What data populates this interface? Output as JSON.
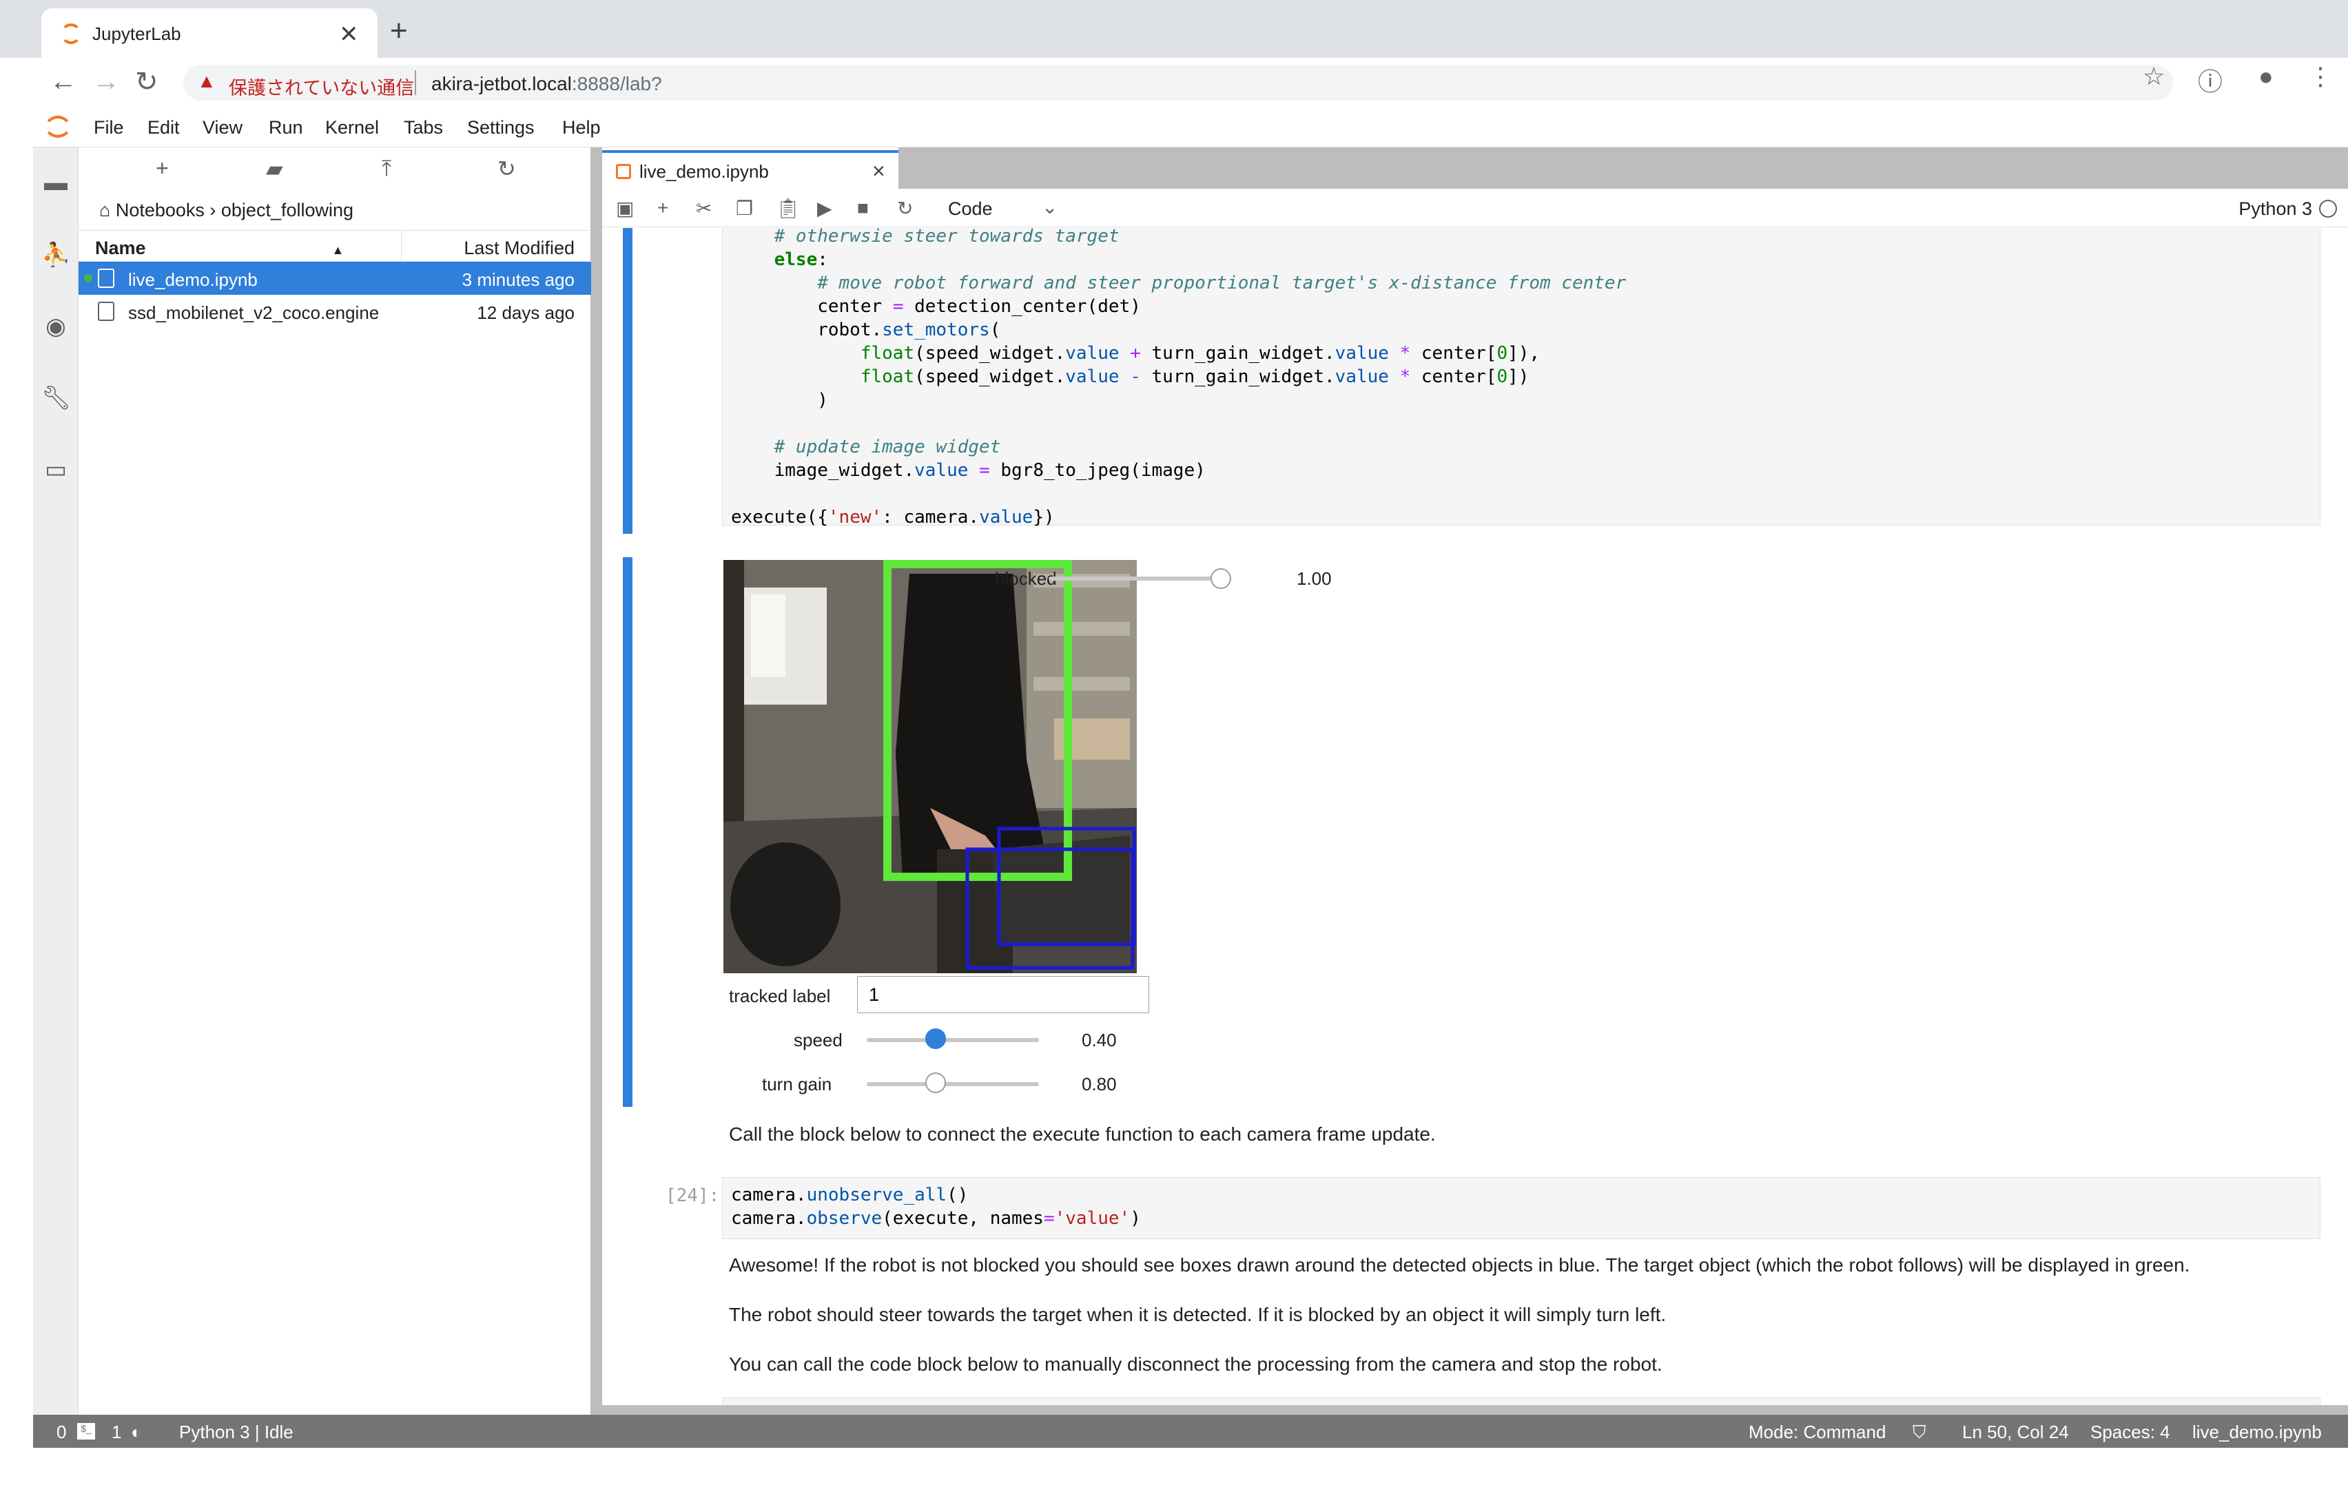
{
  "browser": {
    "tab_title": "JupyterLab",
    "tab_close": "✕",
    "new_tab": "+",
    "security_warning": "保護されていない通信",
    "url_host": "akira-jetbot.local",
    "url_rest": ":8888/lab?"
  },
  "menu": [
    "File",
    "Edit",
    "View",
    "Run",
    "Kernel",
    "Tabs",
    "Settings",
    "Help"
  ],
  "filebrowser": {
    "breadcrumb": "Notebooks › object_following",
    "col_name": "Name",
    "col_modified": "Last Modified",
    "files": [
      {
        "name": "live_demo.ipynb",
        "modified": "3 minutes ago"
      },
      {
        "name": "ssd_mobilenet_v2_coco.engine",
        "modified": "12 days ago"
      }
    ]
  },
  "notebook": {
    "tab_title": "live_demo.ipynb",
    "cell_type": "Code",
    "kernel": "Python 3",
    "cell1_last_line": "execute({'new': camera.value})",
    "widgets": {
      "blocked_label": "blocked",
      "blocked_value": "1.00",
      "blocked_level": 1.0,
      "tracked_label": "tracked label",
      "tracked_value": "1",
      "speed_label": "speed",
      "speed_value": "0.40",
      "speed_level": 0.4,
      "turn_gain_label": "turn gain",
      "turn_gain_value": "0.80",
      "turn_gain_level": 0.4
    },
    "md1": "Call the block below to connect the execute function to each camera frame update.",
    "cell2_prompt": "[24]:",
    "md2": "Awesome! If the robot is not blocked you should see boxes drawn around the detected objects in blue. The target object (which the robot follows) will be displayed in green.",
    "md3": "The robot should steer towards the target when it is detected. If it is blocked by an object it will simply turn left.",
    "md4": "You can call the code block below to manually disconnect the processing from the camera and stop the robot."
  },
  "statusbar": {
    "terminals": "0",
    "kernels": "1",
    "kernel_status": "Python 3 | Idle",
    "mode": "Mode: Command",
    "cursor": "Ln 50, Col 24",
    "spaces": "Spaces: 4",
    "file": "live_demo.ipynb"
  },
  "colors": {
    "accent": "#2f7fdb",
    "statusbar": "#757575",
    "bbox_target": "#5ee83a",
    "bbox_other": "#1a1ad4"
  }
}
